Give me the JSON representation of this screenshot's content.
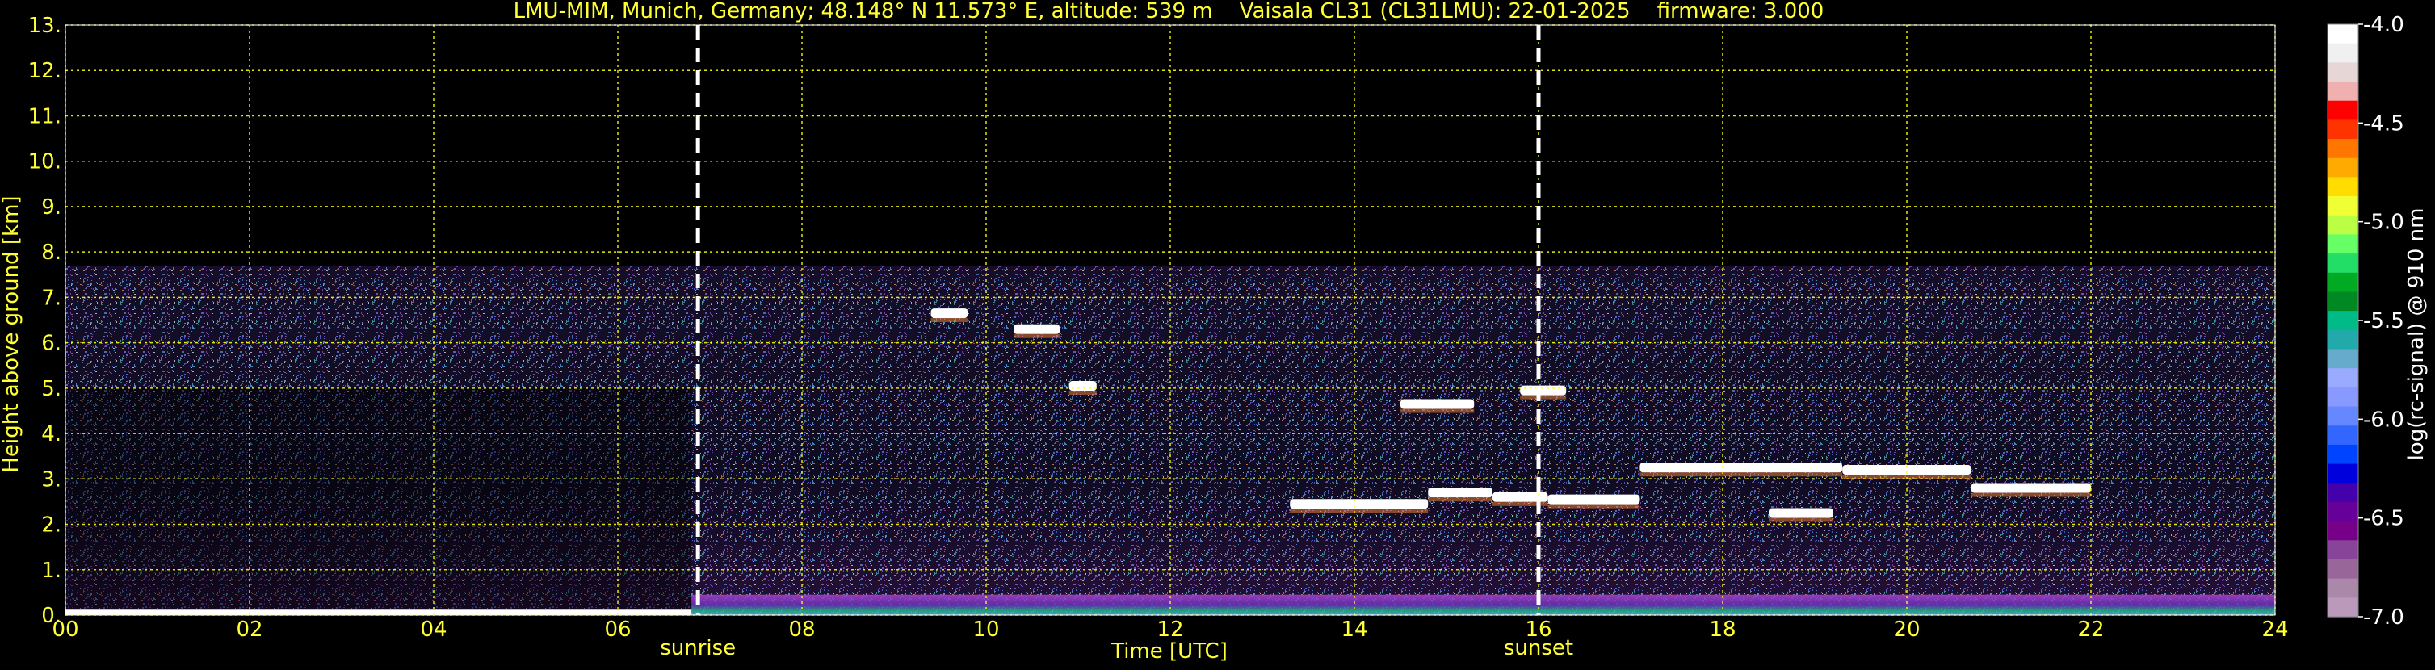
{
  "chart_data": {
    "type": "heatmap",
    "title": "LMU-MIM, Munich, Germany; 48.148° N 11.573° E, altitude: 539 m    Vaisala CL31 (CL31LMU): 22-01-2025    firmware: 3.000",
    "xlabel": "Time [UTC]",
    "ylabel": "Height above ground [km]",
    "x_ticks": [
      "00",
      "02",
      "04",
      "06",
      "08",
      "10",
      "12",
      "14",
      "16",
      "18",
      "20",
      "22",
      "24"
    ],
    "y_ticks": [
      "0.",
      "1.",
      "2.",
      "3.",
      "4.",
      "5.",
      "6.",
      "7.",
      "8.",
      "9.",
      "10.",
      "11.",
      "12.",
      "13."
    ],
    "xlim": [
      0,
      24
    ],
    "ylim": [
      0,
      13
    ],
    "grid": true,
    "grid_color": "#ffff00",
    "tick_label_color": "#ffff33",
    "background_color": "#000000",
    "events": [
      {
        "label": "sunrise",
        "time": 6.87
      },
      {
        "label": "sunset",
        "time": 16.0
      }
    ],
    "colorbar": {
      "label": "log(rc-signal) @ 910 nm",
      "ticks": [
        "-4.0",
        "-4.5",
        "-5.0",
        "-5.5",
        "-6.0",
        "-6.5",
        "-7.0"
      ],
      "range": [
        -7.0,
        -4.0
      ],
      "colors": [
        "#ffffff",
        "#f0f0f0",
        "#e6d6d6",
        "#f0b0b0",
        "#ff0000",
        "#ff3300",
        "#ff7700",
        "#ffaa00",
        "#ffdd00",
        "#f0ff33",
        "#bbff44",
        "#66ff66",
        "#22dd66",
        "#00aa22",
        "#008822",
        "#00bb88",
        "#22aaaa",
        "#66aacc",
        "#99aaff",
        "#8899ff",
        "#6688ff",
        "#3366ff",
        "#0044ff",
        "#0000dd",
        "#4400aa",
        "#660099",
        "#770088",
        "#884499",
        "#996699",
        "#aa88aa",
        "#bb99bb"
      ]
    },
    "features": {
      "signal_top_km": 7.7,
      "ground_layer_km": 0.12,
      "cloud_layers": [
        {
          "t": [
            13.3,
            14.8
          ],
          "h": 2.45
        },
        {
          "t": [
            14.8,
            15.5
          ],
          "h": 2.7
        },
        {
          "t": [
            15.5,
            16.1
          ],
          "h": 2.6
        },
        {
          "t": [
            16.1,
            17.1
          ],
          "h": 2.55
        },
        {
          "t": [
            17.1,
            19.3
          ],
          "h": 3.25
        },
        {
          "t": [
            19.3,
            20.7
          ],
          "h": 3.2
        },
        {
          "t": [
            20.7,
            22.0
          ],
          "h": 2.8
        },
        {
          "t": [
            18.5,
            19.2
          ],
          "h": 2.25
        },
        {
          "t": [
            14.5,
            15.3
          ],
          "h": 4.65
        },
        {
          "t": [
            15.8,
            16.3
          ],
          "h": 4.95
        },
        {
          "t": [
            10.3,
            10.8
          ],
          "h": 6.3
        },
        {
          "t": [
            9.4,
            9.8
          ],
          "h": 6.65
        },
        {
          "t": [
            10.9,
            11.2
          ],
          "h": 5.05
        }
      ]
    }
  }
}
